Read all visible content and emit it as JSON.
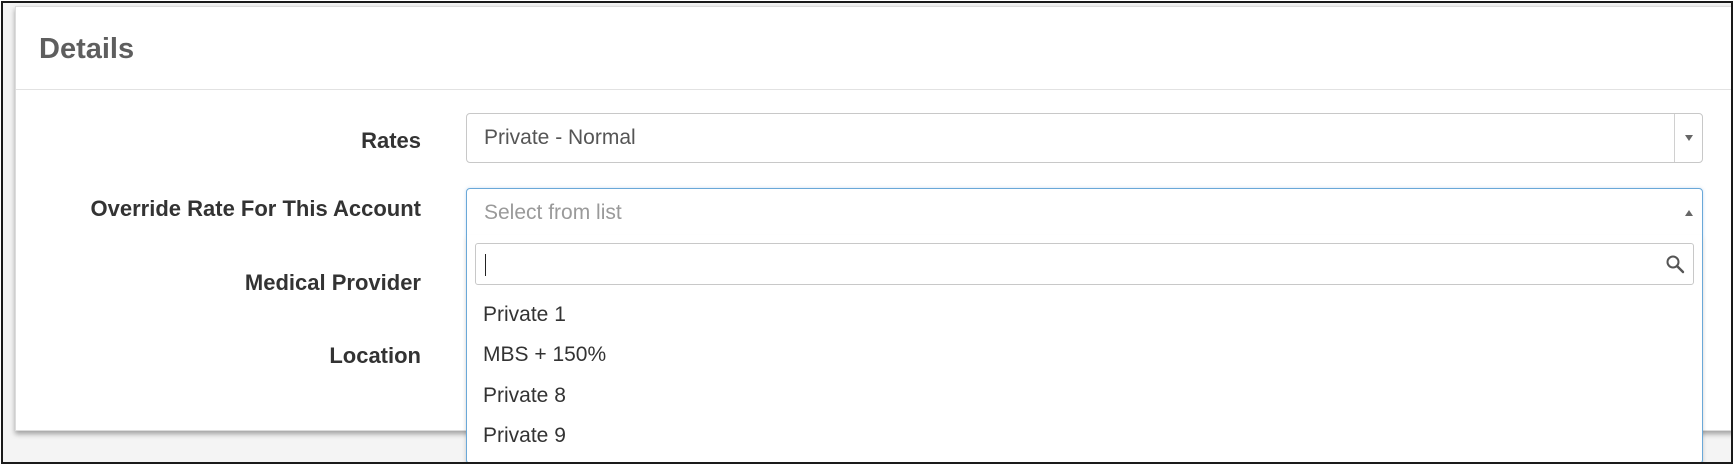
{
  "panel": {
    "title": "Details"
  },
  "form": {
    "rates": {
      "label": "Rates",
      "value": "Private - Normal"
    },
    "override_rate": {
      "label": "Override Rate For This Account",
      "placeholder": "Select from list",
      "search_value": "",
      "options": [
        "Private 1",
        "MBS + 150%",
        "Private 8",
        "Private 9"
      ]
    },
    "medical_provider": {
      "label": "Medical Provider"
    },
    "location": {
      "label": "Location"
    }
  },
  "icons": {
    "dropdown_arrow": "chevron-down-icon",
    "dropdown_arrow_open": "chevron-up-icon",
    "search": "search-icon"
  },
  "colors": {
    "focus_border": "#6aa8d8",
    "title_text": "#5e5e5e",
    "label_text": "#333333",
    "placeholder_text": "#9a9a9a"
  }
}
